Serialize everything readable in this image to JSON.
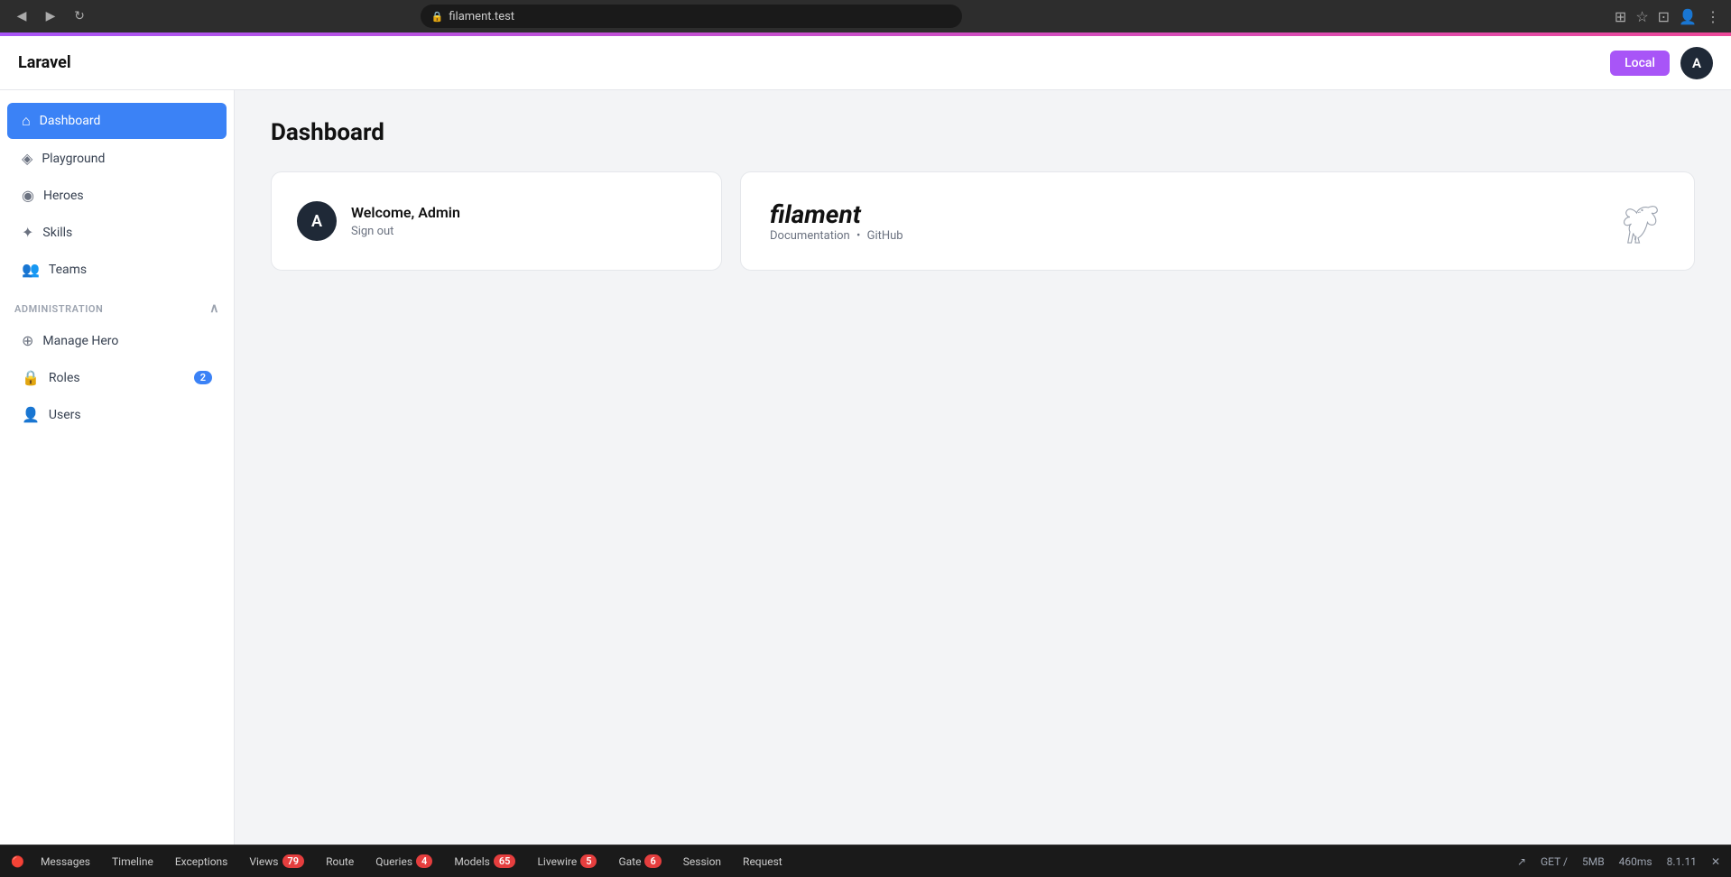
{
  "browser": {
    "url": "filament.test",
    "back_icon": "◀",
    "forward_icon": "▶",
    "refresh_icon": "↻"
  },
  "app": {
    "logo": "Laravel",
    "local_badge": "Local",
    "user_initial": "A"
  },
  "sidebar": {
    "nav_items": [
      {
        "id": "dashboard",
        "label": "Dashboard",
        "icon": "⌂",
        "active": true
      },
      {
        "id": "playground",
        "label": "Playground",
        "icon": "🎮",
        "active": false
      },
      {
        "id": "heroes",
        "label": "Heroes",
        "icon": "🛡",
        "active": false
      },
      {
        "id": "skills",
        "label": "Skills",
        "icon": "✦",
        "active": false
      },
      {
        "id": "teams",
        "label": "Teams",
        "icon": "👤",
        "active": false
      }
    ],
    "admin_section": "ADMINISTRATION",
    "admin_items": [
      {
        "id": "manage-hero",
        "label": "Manage Hero",
        "icon": "⊕",
        "badge": null
      },
      {
        "id": "roles",
        "label": "Roles",
        "icon": "🔒",
        "badge": "2"
      },
      {
        "id": "users",
        "label": "Users",
        "icon": "👤",
        "badge": null
      }
    ]
  },
  "main": {
    "page_title": "Dashboard",
    "welcome_card": {
      "user_initial": "A",
      "welcome_text": "Welcome, Admin",
      "sign_out": "Sign out"
    },
    "filament_card": {
      "brand": "filament",
      "documentation": "Documentation",
      "separator": "•",
      "github": "GitHub"
    }
  },
  "debug_bar": {
    "tabs": [
      {
        "id": "messages",
        "label": "Messages",
        "badge": null
      },
      {
        "id": "timeline",
        "label": "Timeline",
        "badge": null
      },
      {
        "id": "exceptions",
        "label": "Exceptions",
        "badge": null
      },
      {
        "id": "views",
        "label": "Views",
        "badge": "79"
      },
      {
        "id": "route",
        "label": "Route",
        "badge": null
      },
      {
        "id": "queries",
        "label": "Queries",
        "badge": "4"
      },
      {
        "id": "models",
        "label": "Models",
        "badge": "65"
      },
      {
        "id": "livewire",
        "label": "Livewire",
        "badge": "5"
      },
      {
        "id": "gate",
        "label": "Gate",
        "badge": "6"
      },
      {
        "id": "session",
        "label": "Session",
        "badge": null
      },
      {
        "id": "request",
        "label": "Request",
        "badge": null
      }
    ],
    "right": {
      "method": "GET /",
      "memory": "5MB",
      "time": "460ms",
      "php": "8.1.11"
    }
  }
}
